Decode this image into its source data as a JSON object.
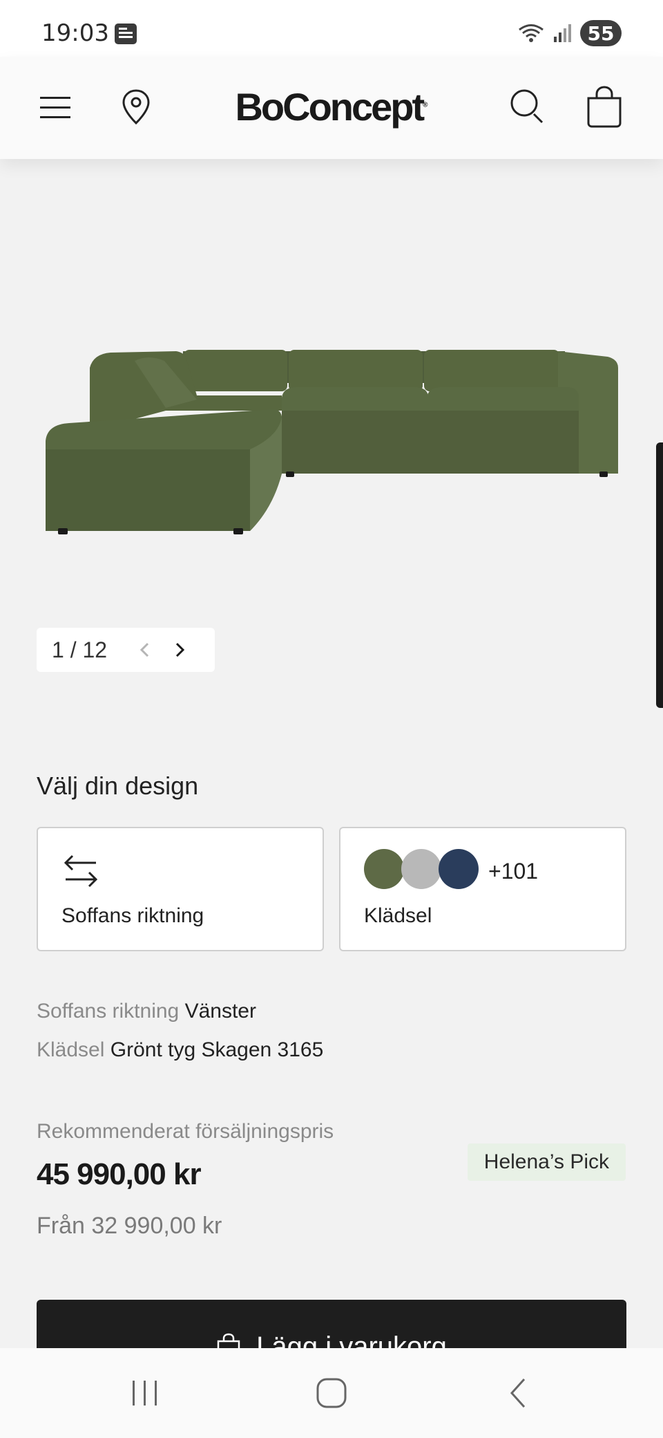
{
  "status_bar": {
    "time": "19:03",
    "battery": "55"
  },
  "header": {
    "brand": "BoConcept",
    "brand_mark": "®"
  },
  "gallery": {
    "counter": "1 / 12"
  },
  "design": {
    "title": "Välj din design",
    "direction_card": {
      "label": "Soffans riktning",
      "icon": "arrows-left-right-icon"
    },
    "upholstery_card": {
      "label": "Klädsel",
      "more": "+101",
      "swatch_colors": [
        "#5e6a46",
        "#b8b8b8",
        "#2a3d5c"
      ]
    }
  },
  "specs": [
    {
      "key": "Soffans riktning",
      "value": "Vänster"
    },
    {
      "key": "Klädsel",
      "value": "Grönt tyg Skagen 3165"
    }
  ],
  "pricing": {
    "label": "Rekommenderat försäljningspris",
    "price": "45 990,00 kr",
    "from": "Från 32 990,00 kr",
    "badge": "Helena’s Pick"
  },
  "cart": {
    "label": "Lägg i varukorg"
  },
  "colors": {
    "sofa": "#5a6a44",
    "button": "#1e1e1e",
    "badge": "#e8f1e6"
  }
}
